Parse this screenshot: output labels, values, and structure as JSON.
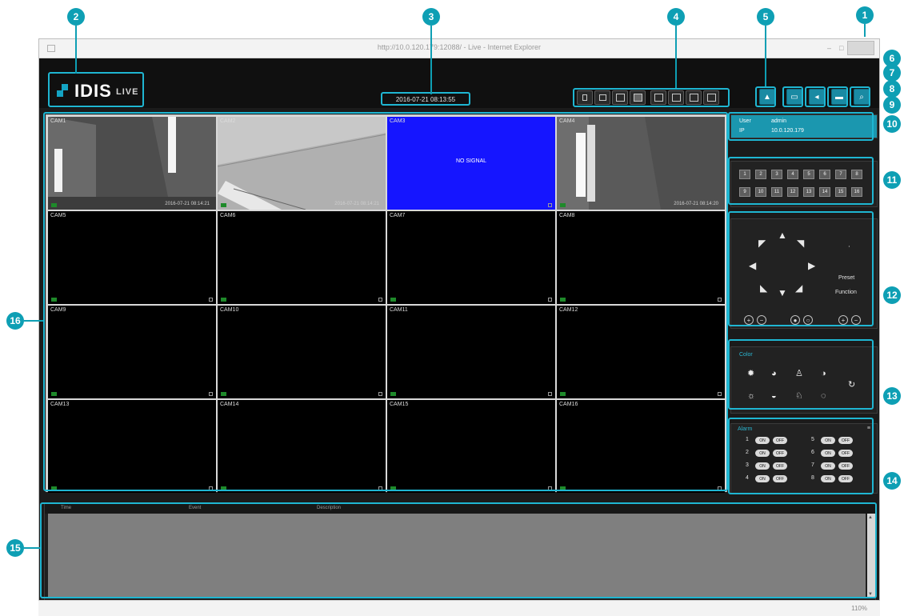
{
  "window": {
    "url_title": "http://10.0.120.179:12088/ - Live - Internet Explorer",
    "minimize": "–",
    "maximize": "□"
  },
  "app": {
    "brand": "IDIS",
    "mode": "LIVE",
    "datetime": "2016-07-21 08:13:55"
  },
  "layout_buttons": [
    "1x1",
    "2x2",
    "3x3",
    "4x4",
    "1+5",
    "1+7",
    "1+12",
    "full"
  ],
  "toolbar_buttons": [
    "login",
    "snapshot",
    "audio",
    "record",
    "search"
  ],
  "info": {
    "user_label": "User",
    "user_value": "admin",
    "ip_label": "IP",
    "ip_value": "10.0.120.179"
  },
  "cameras": [
    {
      "label": "CAM1",
      "timestamp": "2016-07-21 08:14:21",
      "view": "corridor"
    },
    {
      "label": "CAM2",
      "timestamp": "2016-07-21 08:14:21",
      "view": "ceiling"
    },
    {
      "label": "CAM3",
      "timestamp": "",
      "view": "nosignal",
      "nosignal_text": "NO SIGNAL"
    },
    {
      "label": "CAM4",
      "timestamp": "2016-07-21 08:14:20",
      "view": "light"
    },
    {
      "label": "CAM5",
      "timestamp": "",
      "view": "black"
    },
    {
      "label": "CAM6",
      "timestamp": "",
      "view": "black"
    },
    {
      "label": "CAM7",
      "timestamp": "",
      "view": "black"
    },
    {
      "label": "CAM8",
      "timestamp": "",
      "view": "black"
    },
    {
      "label": "CAM9",
      "timestamp": "",
      "view": "black"
    },
    {
      "label": "CAM10",
      "timestamp": "",
      "view": "black"
    },
    {
      "label": "CAM11",
      "timestamp": "",
      "view": "black"
    },
    {
      "label": "CAM12",
      "timestamp": "",
      "view": "black"
    },
    {
      "label": "CAM13",
      "timestamp": "",
      "view": "black"
    },
    {
      "label": "CAM14",
      "timestamp": "",
      "view": "black"
    },
    {
      "label": "CAM15",
      "timestamp": "",
      "view": "black"
    },
    {
      "label": "CAM16",
      "timestamp": "",
      "view": "black"
    }
  ],
  "channels": [
    "1",
    "2",
    "3",
    "4",
    "5",
    "6",
    "7",
    "8",
    "9",
    "10",
    "11",
    "12",
    "13",
    "14",
    "15",
    "16"
  ],
  "ptz": {
    "preset": "Preset",
    "function": "Function"
  },
  "color": {
    "title": "Color"
  },
  "alarm": {
    "title": "Alarm",
    "rows": [
      {
        "num": "1",
        "on": "ON",
        "off": "OFF"
      },
      {
        "num": "2",
        "on": "ON",
        "off": "OFF"
      },
      {
        "num": "3",
        "on": "ON",
        "off": "OFF"
      },
      {
        "num": "4",
        "on": "ON",
        "off": "OFF"
      },
      {
        "num": "5",
        "on": "ON",
        "off": "OFF"
      },
      {
        "num": "6",
        "on": "ON",
        "off": "OFF"
      },
      {
        "num": "7",
        "on": "ON",
        "off": "OFF"
      },
      {
        "num": "8",
        "on": "ON",
        "off": "OFF"
      }
    ]
  },
  "log": {
    "col1": "Time",
    "col2": "Event",
    "col3": "Description"
  },
  "statusbar": {
    "zoom": "110%"
  },
  "callouts": [
    "1",
    "2",
    "3",
    "4",
    "5",
    "6",
    "7",
    "8",
    "9",
    "10",
    "11",
    "12",
    "13",
    "14",
    "15",
    "16"
  ]
}
